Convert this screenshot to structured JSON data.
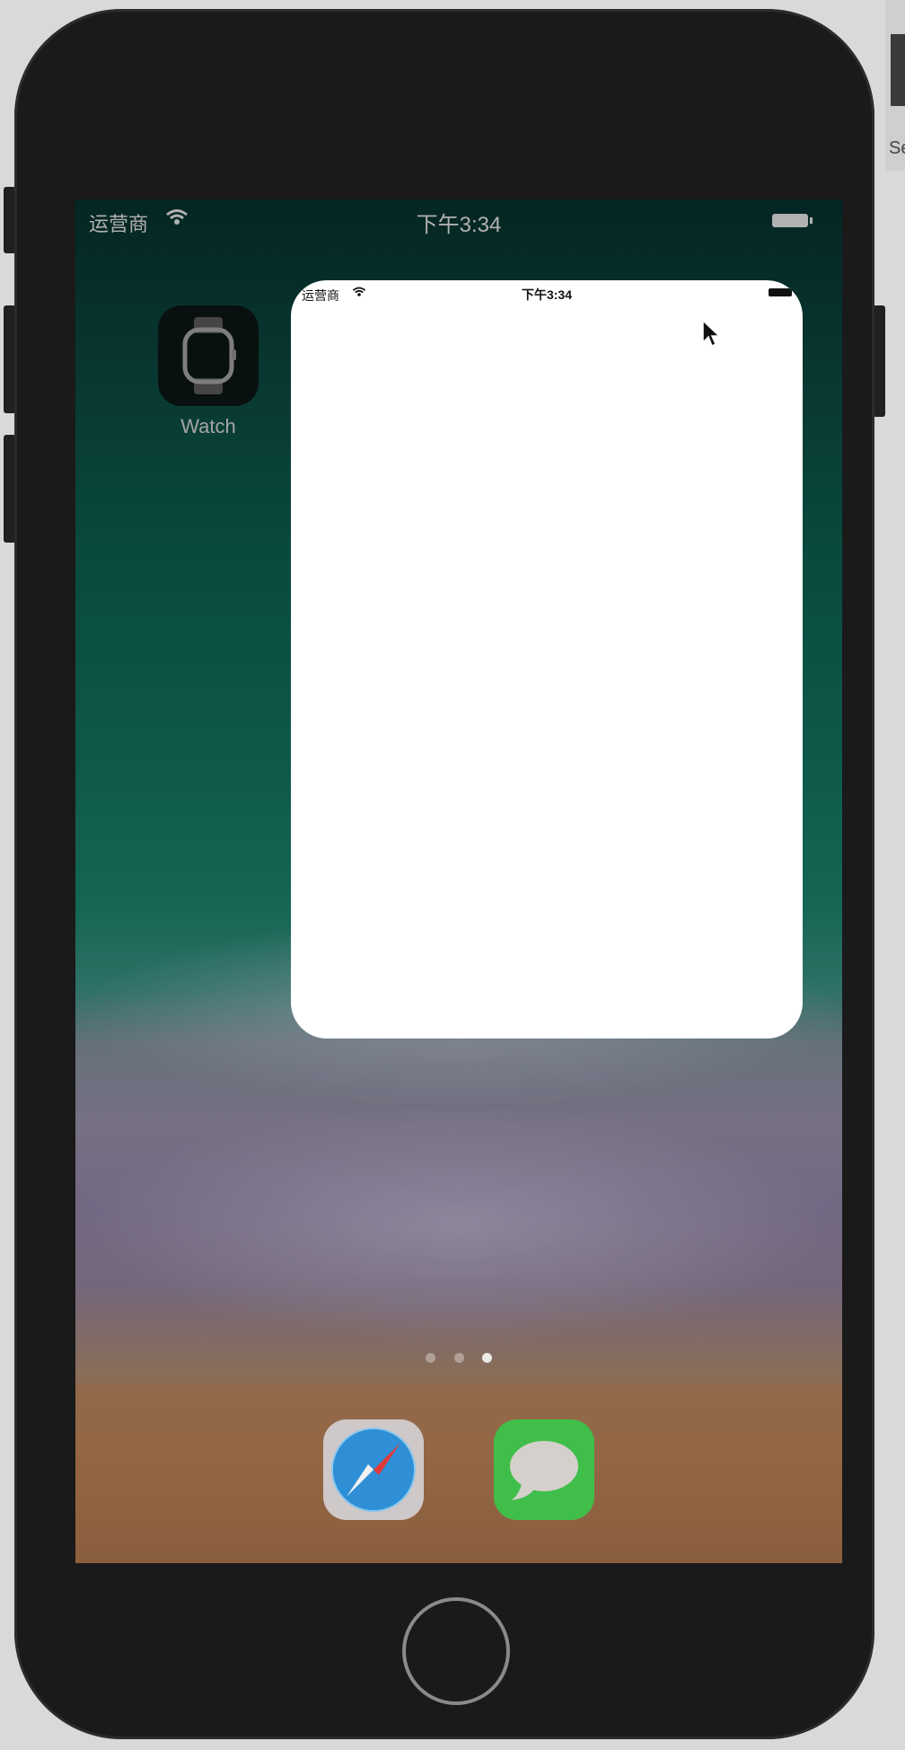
{
  "statusbar": {
    "carrier": "运营商",
    "time": "下午3:34"
  },
  "home_apps": [
    {
      "label": "Watch",
      "icon": "watch-icon"
    }
  ],
  "dock_apps": [
    {
      "label": "Safari",
      "icon": "safari-icon"
    },
    {
      "label": "Messages",
      "icon": "messages-icon"
    }
  ],
  "page_indicator": {
    "count": 3,
    "active_index": 2
  },
  "sheet": {
    "status_carrier": "运营商",
    "status_time": "下午3:34"
  },
  "side_window": {
    "label": "Se"
  },
  "colors": {
    "phone_body": "#1a1a1a",
    "sheet_bg": "#ffffff",
    "messages_green": "#3fbf4a",
    "safari_blue": "#2e8fd6"
  }
}
